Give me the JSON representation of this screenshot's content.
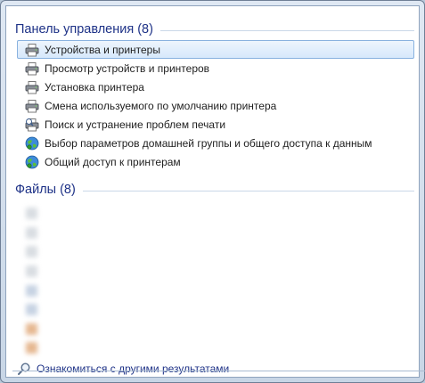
{
  "control_panel": {
    "header": "Панель управления (8)",
    "items": [
      {
        "label": "Устройства и принтеры",
        "icon": "printer-icon",
        "selected": true
      },
      {
        "label": "Просмотр устройств и принтеров",
        "icon": "printer-icon",
        "selected": false
      },
      {
        "label": "Установка принтера",
        "icon": "printer-icon",
        "selected": false
      },
      {
        "label": "Смена используемого по умолчанию принтера",
        "icon": "printer-icon",
        "selected": false
      },
      {
        "label": "Поиск и устранение проблем печати",
        "icon": "troubleshoot-icon",
        "selected": false
      },
      {
        "label": "Выбор параметров домашней группы и общего доступа к данным",
        "icon": "network-globe-icon",
        "selected": false
      },
      {
        "label": "Общий доступ к принтерам",
        "icon": "network-globe-icon",
        "selected": false
      }
    ]
  },
  "files": {
    "header": "Файлы (8)",
    "items": [
      {
        "name": "",
        "icon_color": "#d9dde2"
      },
      {
        "name": "",
        "icon_color": "#d9dde2"
      },
      {
        "name": "",
        "icon_color": "#d9dde2"
      },
      {
        "name": "",
        "icon_color": "#d9dde2"
      },
      {
        "name": "",
        "icon_color": "#c7d3e3"
      },
      {
        "name": "",
        "icon_color": "#c7d3e3"
      },
      {
        "name": "",
        "icon_color": "#e6b891"
      },
      {
        "name": "",
        "icon_color": "#e6b891"
      }
    ]
  },
  "more_results": {
    "label": "Ознакомиться с другими результатами",
    "icon": "magnifier-icon"
  },
  "colors": {
    "header_text": "#1e3287",
    "selection_border": "#89b2df",
    "selection_fill": "#d6e8fb"
  }
}
